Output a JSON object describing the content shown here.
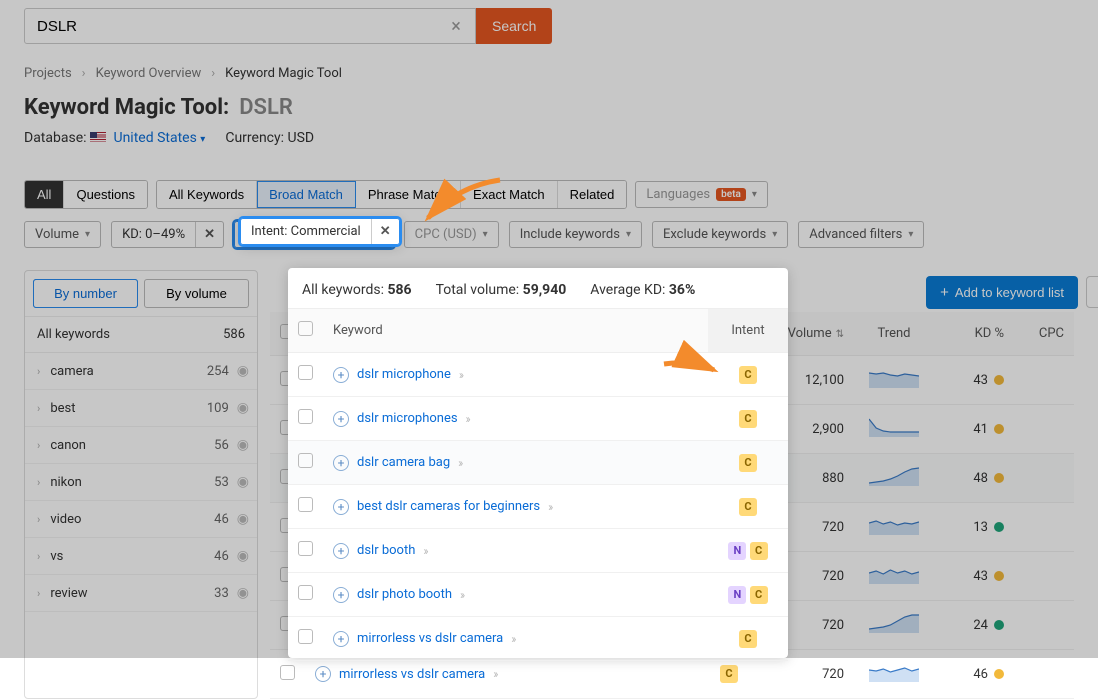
{
  "search": {
    "value": "DSLR",
    "button": "Search"
  },
  "breadcrumb": [
    "Projects",
    "Keyword Overview",
    "Keyword Magic Tool"
  ],
  "title": {
    "label": "Keyword Magic Tool:",
    "keyword": "DSLR"
  },
  "database": {
    "label": "Database:",
    "country": "United States"
  },
  "currency": {
    "label": "Currency: USD"
  },
  "segment1": [
    "All",
    "Questions"
  ],
  "segment2": [
    "All Keywords",
    "Broad Match",
    "Phrase Match",
    "Exact Match",
    "Related"
  ],
  "languages_label": "Languages",
  "beta": "beta",
  "filters": {
    "volume": "Volume",
    "kd_chip": "KD: 0–49%",
    "intent_chip": "Intent: Commercial",
    "cpc": "CPC (USD)",
    "include": "Include keywords",
    "exclude": "Exclude keywords",
    "advanced": "Advanced filters"
  },
  "side_tabs": [
    "By number",
    "By volume"
  ],
  "side_all": {
    "label": "All keywords",
    "count": "586"
  },
  "side_items": [
    {
      "name": "camera",
      "count": "254"
    },
    {
      "name": "best",
      "count": "109"
    },
    {
      "name": "canon",
      "count": "56"
    },
    {
      "name": "nikon",
      "count": "53"
    },
    {
      "name": "video",
      "count": "46"
    },
    {
      "name": "vs",
      "count": "46"
    },
    {
      "name": "review",
      "count": "33"
    }
  ],
  "stats": {
    "all_label": "All keywords:",
    "all_val": "586",
    "vol_label": "Total volume:",
    "vol_val": "59,940",
    "kd_label": "Average KD:",
    "kd_val": "36%"
  },
  "add_btn": "Add to keyword list",
  "columns": {
    "keyword": "Keyword",
    "intent": "Intent",
    "volume": "Volume",
    "trend": "Trend",
    "kd": "KD %",
    "cpc": "CPC"
  },
  "rows": [
    {
      "kw": "dslr microphone",
      "intent": [
        "C"
      ],
      "vol": "12,100",
      "kd": "43",
      "kdc": "y",
      "spark": "15,14,15,13,12,14,13,12"
    },
    {
      "kw": "dslr microphones",
      "intent": [
        "C"
      ],
      "vol": "2,900",
      "kd": "41",
      "kdc": "y",
      "spark": "18,9,6,5,5,5,5,5"
    },
    {
      "kw": "dslr camera bag",
      "intent": [
        "C"
      ],
      "vol": "880",
      "kd": "48",
      "kdc": "y",
      "spark": "3,4,5,7,10,14,17,18"
    },
    {
      "kw": "best dslr cameras for beginners",
      "intent": [
        "C"
      ],
      "vol": "720",
      "kd": "13",
      "kdc": "g",
      "spark": "12,14,11,13,10,12,11,13"
    },
    {
      "kw": "dslr booth",
      "intent": [
        "N",
        "C"
      ],
      "vol": "720",
      "kd": "43",
      "kdc": "y",
      "spark": "11,13,10,14,11,13,10,12"
    },
    {
      "kw": "dslr photo booth",
      "intent": [
        "N",
        "C"
      ],
      "vol": "720",
      "kd": "24",
      "kdc": "g",
      "spark": "4,5,6,8,12,16,18,18"
    },
    {
      "kw": "mirrorless vs dslr camera",
      "intent": [
        "C"
      ],
      "vol": "720",
      "kd": "46",
      "kdc": "y",
      "spark": "12,11,13,10,12,14,11,13"
    }
  ]
}
